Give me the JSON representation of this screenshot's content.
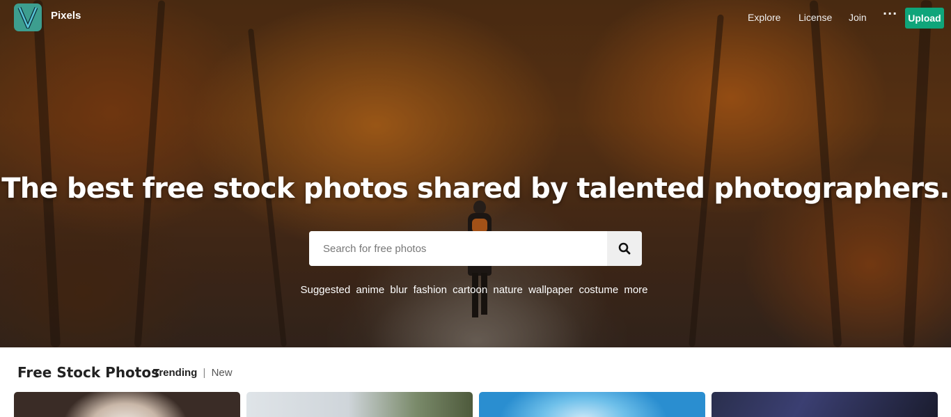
{
  "brand": {
    "name": "Pixels",
    "logo_letter": "V"
  },
  "nav": {
    "links": [
      "Explore",
      "License",
      "Join"
    ],
    "more": "···",
    "upload_label": "Upload"
  },
  "hero": {
    "headline": "The best free stock photos shared by talented photographers.",
    "search_placeholder": "Search for free photos",
    "suggested_label": "Suggested",
    "suggested_tags": [
      "anime",
      "blur",
      "fashion",
      "cartoon",
      "nature",
      "wallpaper",
      "costume",
      "more"
    ]
  },
  "section": {
    "title": "Free Stock Photos",
    "filter_active": "Trending",
    "filter_separator": "|",
    "filter_other": "New"
  },
  "colors": {
    "accent": "#0fa57a",
    "logo_bg": "#3d9e8f"
  }
}
